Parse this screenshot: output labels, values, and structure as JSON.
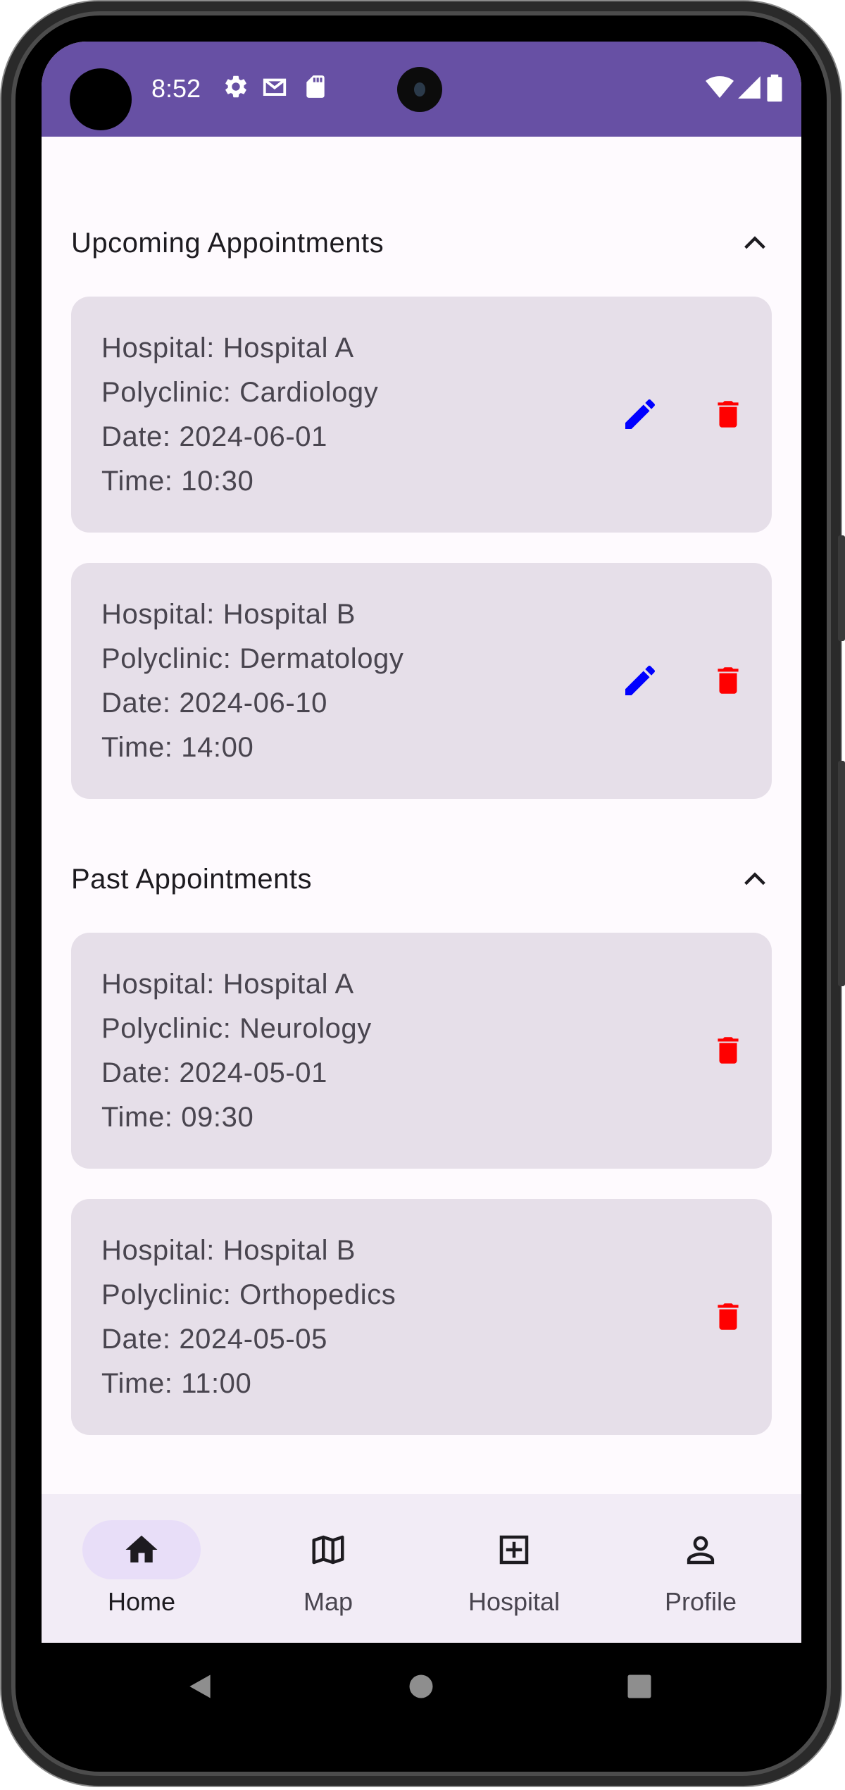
{
  "status_bar": {
    "time": "8:52",
    "icons": [
      "settings-icon",
      "gmail-icon",
      "sd-card-icon",
      "wifi-icon",
      "signal-icon",
      "battery-icon"
    ]
  },
  "sections": [
    {
      "title": "Upcoming Appointments",
      "expanded": true,
      "appointments": [
        {
          "hospital": "Hospital: Hospital A",
          "polyclinic": "Polyclinic: Cardiology",
          "date": "Date: 2024-06-01",
          "time": "Time: 10:30",
          "editable": true
        },
        {
          "hospital": "Hospital: Hospital B",
          "polyclinic": "Polyclinic: Dermatology",
          "date": "Date: 2024-06-10",
          "time": "Time: 14:00",
          "editable": true
        }
      ]
    },
    {
      "title": "Past Appointments",
      "expanded": true,
      "appointments": [
        {
          "hospital": "Hospital: Hospital A",
          "polyclinic": "Polyclinic: Neurology",
          "date": "Date: 2024-05-01",
          "time": "Time: 09:30",
          "editable": false
        },
        {
          "hospital": "Hospital: Hospital B",
          "polyclinic": "Polyclinic: Orthopedics",
          "date": "Date: 2024-05-05",
          "time": "Time: 11:00",
          "editable": false
        }
      ]
    }
  ],
  "bottom_nav": {
    "selected": "Home",
    "items": [
      {
        "label": "Home",
        "icon": "home-icon"
      },
      {
        "label": "Map",
        "icon": "map-icon"
      },
      {
        "label": "Hospital",
        "icon": "hospital-plus-icon"
      },
      {
        "label": "Profile",
        "icon": "person-icon"
      }
    ]
  },
  "colors": {
    "header": "#6750a4",
    "card": "#e6dfe9",
    "edit_icon": "#0000ff",
    "delete_icon": "#ff0000",
    "nav_background": "#f2ecf6",
    "nav_indicator": "#e8def8"
  }
}
